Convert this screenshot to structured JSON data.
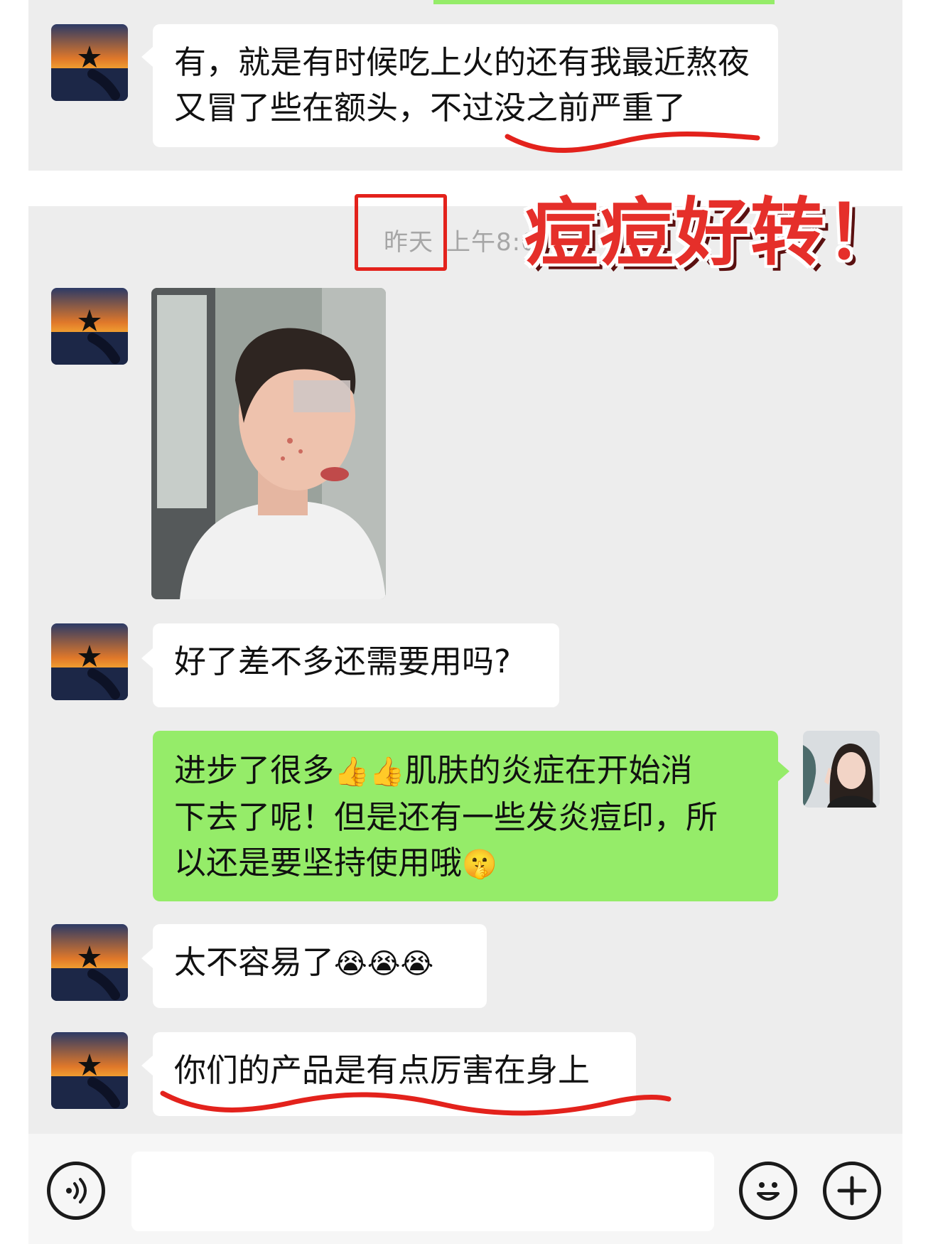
{
  "overlay": {
    "headline": "痘痘好转！"
  },
  "chat": {
    "timestamp_day": "昨天",
    "timestamp_time": "上午8:0",
    "messages": [
      {
        "sender": "customer",
        "text": "有，就是有时候吃上火的还有我最近熬夜又冒了些在额头，不过没之前严重了"
      },
      {
        "sender": "customer",
        "type": "image",
        "description_icon": "selfie-photo"
      },
      {
        "sender": "customer",
        "text": "好了差不多还需要用吗?"
      },
      {
        "sender": "agent",
        "text_line1_a": "进步了很多",
        "emoji1": "👍👍",
        "text_line1_b": "肌肤的炎症在开始消",
        "text_line2": "下去了呢！但是还有一些发炎痘印，所",
        "text_line3": "以还是要坚持使用哦",
        "emoji2": "🤫"
      },
      {
        "sender": "customer",
        "text": "太不容易了",
        "emoji": "😭😭😭"
      },
      {
        "sender": "customer",
        "text": "你们的产品是有点厉害在身上"
      }
    ]
  },
  "input_bar": {
    "voice_icon": "voice-icon",
    "emoji_icon": "emoji-icon",
    "plus_icon": "plus-icon",
    "placeholder": ""
  },
  "colors": {
    "background": "#ededed",
    "bubble_in": "#ffffff",
    "bubble_out": "#95ec69",
    "highlight_red": "#e3221c"
  }
}
